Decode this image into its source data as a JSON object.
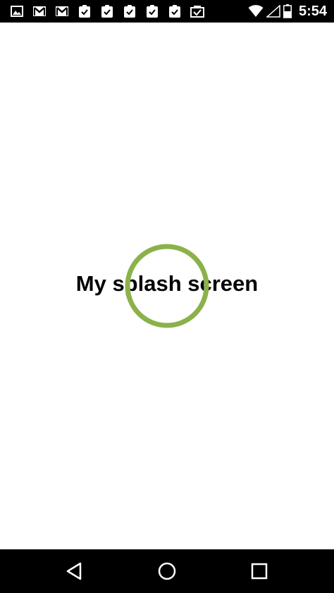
{
  "status_bar": {
    "notification_icons": [
      "image-icon",
      "gmail-icon",
      "gmail-icon",
      "clipboard-check-icon",
      "clipboard-check-icon",
      "clipboard-check-icon",
      "clipboard-check-icon",
      "clipboard-check-icon",
      "photo-check-icon"
    ],
    "time": "5:54",
    "wifi_icon": "wifi-icon",
    "signal_icon": "signal-icon",
    "battery_icon": "battery-icon"
  },
  "splash": {
    "title": "My splash screen",
    "spinner_color": "#8bb24a"
  },
  "nav_bar": {
    "back_icon": "back-icon",
    "home_icon": "home-icon",
    "recents_icon": "recents-icon"
  }
}
